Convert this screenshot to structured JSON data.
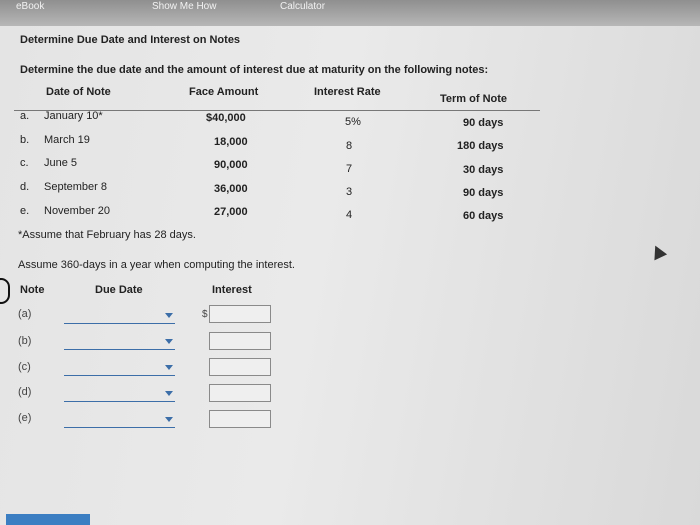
{
  "topbar": {
    "ebook": "eBook",
    "show_me_how": "Show Me How",
    "calculator": "Calculator"
  },
  "heading": "Determine Due Date and Interest on Notes",
  "instructions": "Determine the due date and the amount of interest due at maturity on the following notes:",
  "table": {
    "headers": [
      "Date of Note",
      "Face Amount",
      "Interest Rate",
      "Term of Note"
    ],
    "rows": [
      {
        "letter": "a.",
        "date": "January 10*",
        "face": "$40,000",
        "rate": "5%",
        "term": "90 days"
      },
      {
        "letter": "b.",
        "date": "March 19",
        "face": "18,000",
        "rate": "8",
        "term": "180 days"
      },
      {
        "letter": "c.",
        "date": "June 5",
        "face": "90,000",
        "rate": "7",
        "term": "30 days"
      },
      {
        "letter": "d.",
        "date": "September 8",
        "face": "36,000",
        "rate": "3",
        "term": "90 days"
      },
      {
        "letter": "e.",
        "date": "November 20",
        "face": "27,000",
        "rate": "4",
        "term": "60 days"
      }
    ]
  },
  "footnote": "*Assume that February has 28 days.",
  "assumption": "Assume 360-days in a year when computing the interest.",
  "answer": {
    "headers": {
      "note": "Note",
      "due_date": "Due Date",
      "interest": "Interest"
    },
    "currency": "$",
    "rows": [
      {
        "label": "(a)",
        "due_date": "",
        "interest": ""
      },
      {
        "label": "(b)",
        "due_date": "",
        "interest": ""
      },
      {
        "label": "(c)",
        "due_date": "",
        "interest": ""
      },
      {
        "label": "(d)",
        "due_date": "",
        "interest": ""
      },
      {
        "label": "(e)",
        "due_date": "",
        "interest": ""
      }
    ]
  }
}
